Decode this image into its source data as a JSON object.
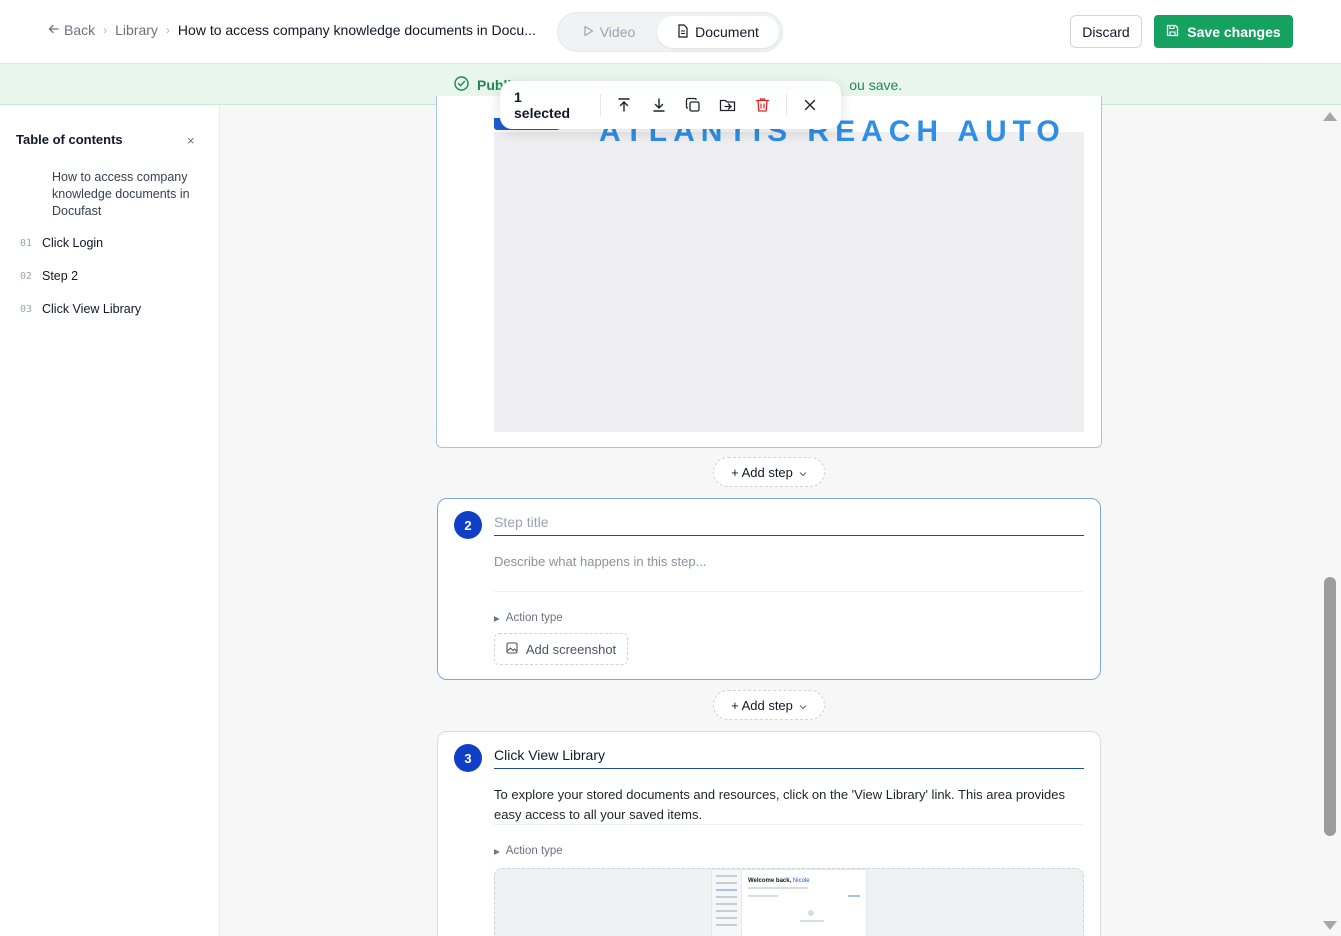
{
  "header": {
    "back_label": "Back",
    "breadcrumb_library": "Library",
    "doc_title": "How to access company knowledge documents in Docu...",
    "toggle": {
      "video_label": "Video",
      "document_label": "Document",
      "selected": "Document"
    },
    "discard_label": "Discard",
    "save_label": "Save changes",
    "save_color": "#15a15f"
  },
  "banner": {
    "visible_bold": "Publi",
    "visible_tail": "ou save.",
    "color": "#e8f6ee"
  },
  "selection_toolbar": {
    "count_label": "1 selected",
    "tools": [
      "move-to-top-icon",
      "move-to-bottom-icon",
      "duplicate-icon",
      "move-to-icon",
      "delete-icon",
      "close-icon"
    ]
  },
  "toc": {
    "title": "Table of contents",
    "close_glyph": "×",
    "document_title": "How to access company knowledge documents in Docufast",
    "items": [
      {
        "num": "01",
        "label": "Click Login"
      },
      {
        "num": "02",
        "label": "Step 2"
      },
      {
        "num": "03",
        "label": "Click View Library"
      }
    ]
  },
  "steps": {
    "add_step_label": "+ Add step",
    "step2": {
      "number": "2",
      "title_placeholder": "Step title",
      "description_placeholder": "Describe what happens in this step...",
      "action_type_label": "Action type",
      "add_screenshot_label": "Add screenshot"
    },
    "step3": {
      "number": "3",
      "title": "Click View Library",
      "description": "To explore your stored documents and resources, click on the 'View Library' link. This area provides easy access to all your saved items.",
      "action_type_label": "Action type",
      "thumbnail_welcome": "Welcome back,",
      "thumbnail_name": "Nicole"
    }
  },
  "accent_color": "#0f3fc7"
}
